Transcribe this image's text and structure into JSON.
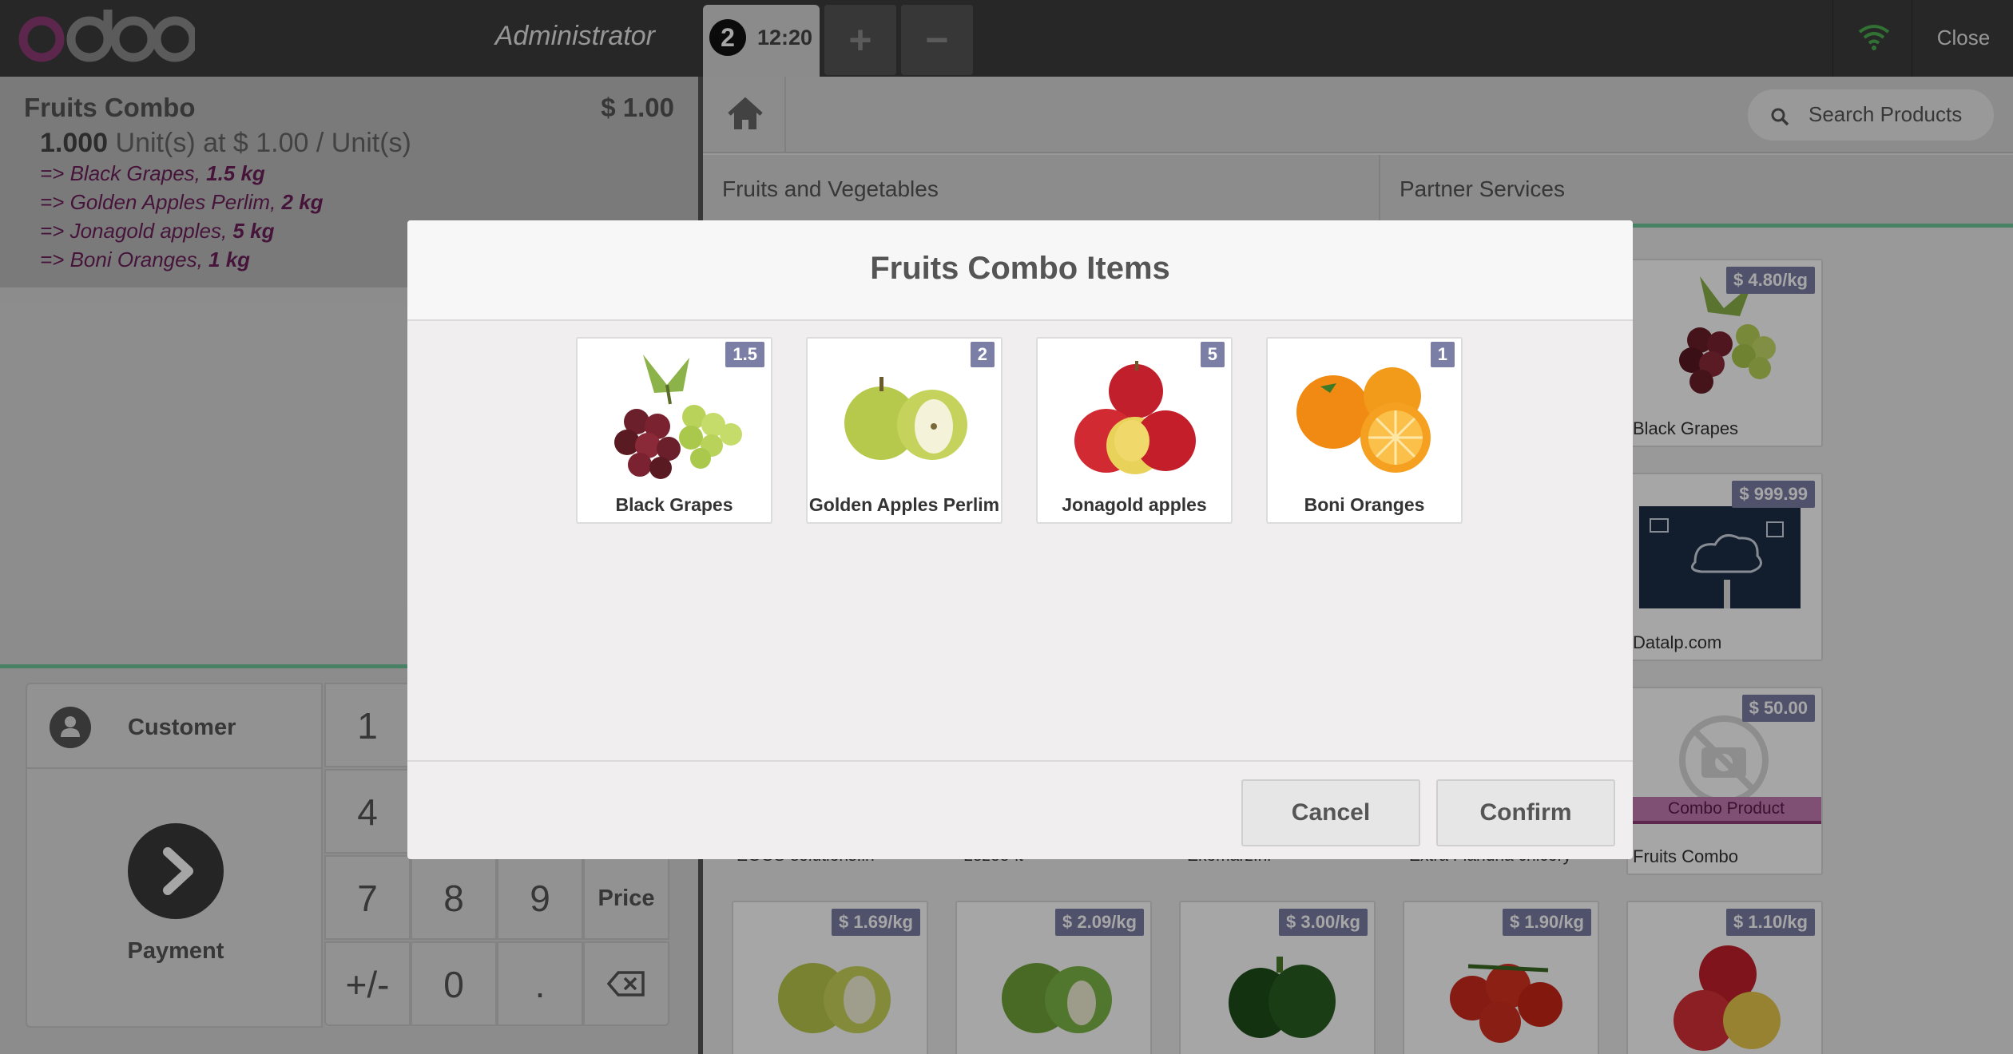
{
  "topbar": {
    "user": "Administrator",
    "order_number": "2",
    "order_time": "12:20",
    "add_order_label": "+",
    "remove_order_label": "−",
    "close_label": "Close",
    "wifi_color": "#4caf50"
  },
  "orderline": {
    "name": "Fruits Combo",
    "price": "$ 1.00",
    "qty": "1.000",
    "qty_suffix": " Unit(s) at $ 1.00 / Unit(s)",
    "combo_items": [
      {
        "prefix": "=> Black Grapes, ",
        "qty": "1.5 kg"
      },
      {
        "prefix": "=> Golden Apples Perlim, ",
        "qty": "2 kg"
      },
      {
        "prefix": "=> Jonagold apples, ",
        "qty": "5 kg"
      },
      {
        "prefix": "=> Boni Oranges, ",
        "qty": "1 kg"
      }
    ]
  },
  "controls": {
    "customer_label": "Customer",
    "payment_label": "Payment",
    "keys": {
      "k1": "1",
      "k4": "4",
      "k7": "7",
      "k8": "8",
      "k9": "9",
      "price": "Price",
      "plusminus": "+/-",
      "k0": "0",
      "dot": "."
    }
  },
  "products_screen": {
    "search_placeholder": "Search Products",
    "categories": [
      "Fruits and Vegetables",
      "Partner Services"
    ],
    "right_column": [
      {
        "price": "$ 4.80/kg",
        "name": "Black Grapes"
      },
      {
        "price": "$ 999.99",
        "name": "Datalp.com"
      },
      {
        "price": "$ 50.00",
        "name": "Fruits Combo",
        "ribbon": "Combo Product"
      }
    ],
    "partial_names": [
      "EGGS-solutions.in",
      "Lezee-it",
      "Ekomarz.nl",
      "Extra Flandria chicory"
    ],
    "bottom_row_prices": [
      "$ 1.69/kg",
      "$ 2.09/kg",
      "$ 3.00/kg",
      "$ 1.90/kg",
      "$ 1.10/kg"
    ]
  },
  "modal": {
    "title": "Fruits Combo Items",
    "items": [
      {
        "name": "Black Grapes",
        "qty": "1.5"
      },
      {
        "name": "Golden Apples Perlim",
        "qty": "2"
      },
      {
        "name": "Jonagold apples",
        "qty": "5"
      },
      {
        "name": "Boni Oranges",
        "qty": "1"
      }
    ],
    "cancel_label": "Cancel",
    "confirm_label": "Confirm"
  },
  "colors": {
    "accent_green": "#6ec89b",
    "combo_purple": "#6c1f5a",
    "tag_blue": "#7b7fa6"
  }
}
